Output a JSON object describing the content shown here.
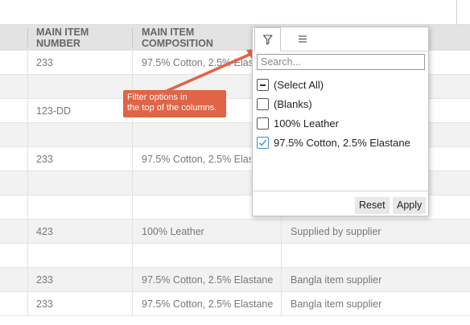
{
  "columns": [
    {
      "label_line1": "MAIN ITEM",
      "label_line2": "NUMBER"
    },
    {
      "label_line1": "MAIN ITEM",
      "label_line2": "COMPOSITION"
    }
  ],
  "rows": [
    {
      "number": "233",
      "composition": "97.5% Cotton, 2.5% Elastane",
      "supplier": ""
    },
    {
      "number": "",
      "composition": "",
      "supplier": ""
    },
    {
      "number": "123-DD",
      "composition": "",
      "supplier": ""
    },
    {
      "number": "",
      "composition": "",
      "supplier": ""
    },
    {
      "number": "233",
      "composition": "97.5% Cotton, 2.5% Elastane",
      "supplier": ""
    },
    {
      "number": "",
      "composition": "",
      "supplier": ""
    },
    {
      "number": "",
      "composition": "",
      "supplier": ""
    },
    {
      "number": "423",
      "composition": "100% Leather",
      "supplier": "Supplied by supplier"
    },
    {
      "number": "",
      "composition": "",
      "supplier": ""
    },
    {
      "number": "233",
      "composition": "97.5% Cotton, 2.5% Elastane",
      "supplier": "Bangla item supplier"
    },
    {
      "number": "233",
      "composition": "97.5% Cotton, 2.5% Elastane",
      "supplier": "Bangla item supplier"
    }
  ],
  "filter_popup": {
    "tabs": [
      {
        "icon": "filter-icon"
      },
      {
        "icon": "menu-icon"
      }
    ],
    "search_placeholder": "Search...",
    "options": [
      {
        "label": "(Select All)",
        "state": "indeterminate"
      },
      {
        "label": "(Blanks)",
        "state": "unchecked"
      },
      {
        "label": "100% Leather",
        "state": "unchecked"
      },
      {
        "label": "97.5% Cotton, 2.5% Elastane",
        "state": "checked"
      }
    ],
    "reset_label": "Reset",
    "apply_label": "Apply"
  },
  "callout": {
    "line1": "Filter options in",
    "line2": "the top of the columns.",
    "color": "#e06446"
  },
  "colors": {
    "checkbox_checked": "#3a8fd0",
    "header_bg": "#e3e3e3",
    "alt_row_bg": "#f2f2f2"
  }
}
